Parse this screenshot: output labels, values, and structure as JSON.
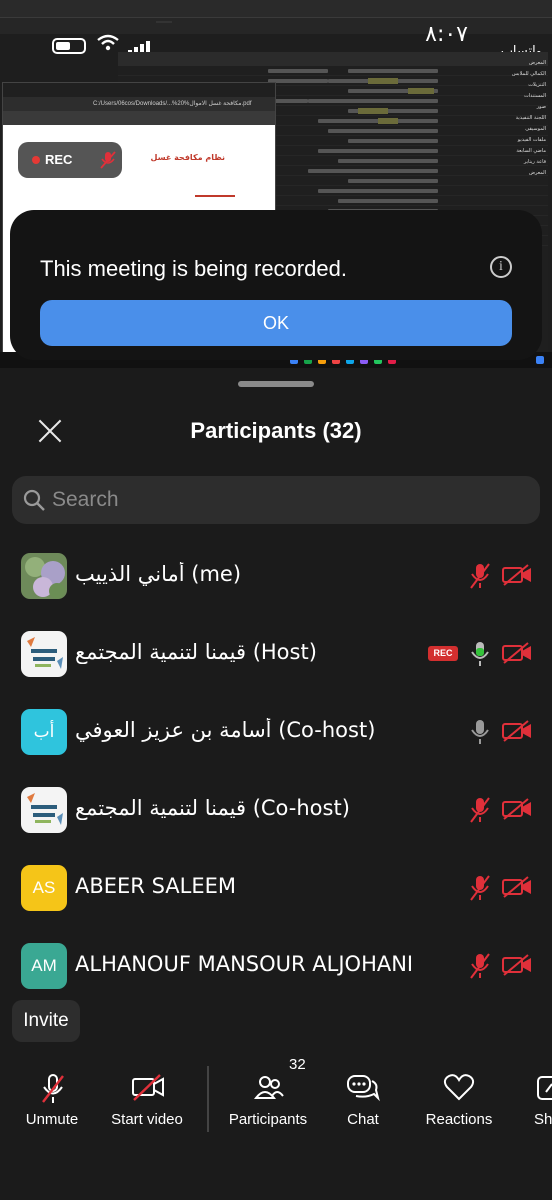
{
  "shared_screen": {
    "phone_clock": "٨:٠٧",
    "phone_app": "واتساب",
    "recording_pill": {
      "label": "REC"
    },
    "pdf_title_line": "نظام مكافحة غسل",
    "pdf_address": "C:/Users/06cos/Downloads/...%20%مكافحة غسل الاموال.pdf",
    "tree_items": [
      "المعرض",
      "الكمالي للملابس",
      "التنزيلات",
      "المستندات",
      "صور",
      "اللجنة التنفيذية",
      "الموسيقى",
      "ملفات الفيديو",
      "ماضي السابعة",
      "قاعة ريتاير",
      "المعرض"
    ],
    "banner": {
      "message": "This meeting is being recorded.",
      "ok_label": "OK"
    }
  },
  "participants_panel": {
    "title": "Participants (32)",
    "search_placeholder": "Search",
    "participants": [
      {
        "name": "أماني الذييب",
        "role": "(me)",
        "avatar": "photo",
        "mic": "muted",
        "video": "off",
        "recording": false
      },
      {
        "name": "قيمنا لتنمية المجتمع",
        "role": "(Host)",
        "avatar": "logo",
        "mic": "active",
        "video": "off",
        "recording": true,
        "recording_label": "REC"
      },
      {
        "name": "أسامة بن عزيز العوفي",
        "role": "(Co-host)",
        "avatar": "initials",
        "initials": "أب",
        "avatar_color": "#2fc4dd",
        "mic": "unmuted",
        "video": "off",
        "recording": false
      },
      {
        "name": "قيمنا لتنمية المجتمع",
        "role": "(Co-host)",
        "avatar": "logo",
        "mic": "muted",
        "video": "off",
        "recording": false
      },
      {
        "name": "ABEER SALEEM",
        "role": "",
        "avatar": "initials",
        "initials": "AS",
        "avatar_color": "#f5c518",
        "mic": "muted",
        "video": "off",
        "recording": false
      },
      {
        "name": "ALHANOUF MANSOUR ALJOHANI",
        "role": "",
        "avatar": "initials",
        "initials": "AM",
        "avatar_color": "#3aa893",
        "mic": "muted",
        "video": "off",
        "recording": false
      }
    ],
    "invite_label": "Invite"
  },
  "bottom_bar": {
    "unmute_label": "Unmute",
    "start_video_label": "Start video",
    "participants_label": "Participants",
    "participants_count": "32",
    "chat_label": "Chat",
    "reactions_label": "Reactions",
    "share_label": "Sh"
  },
  "colors": {
    "panel_bg": "#1b1b1b",
    "muted_red": "#e0303a",
    "active_mic_green": "#35c23b",
    "ok_blue": "#4a8fea"
  }
}
